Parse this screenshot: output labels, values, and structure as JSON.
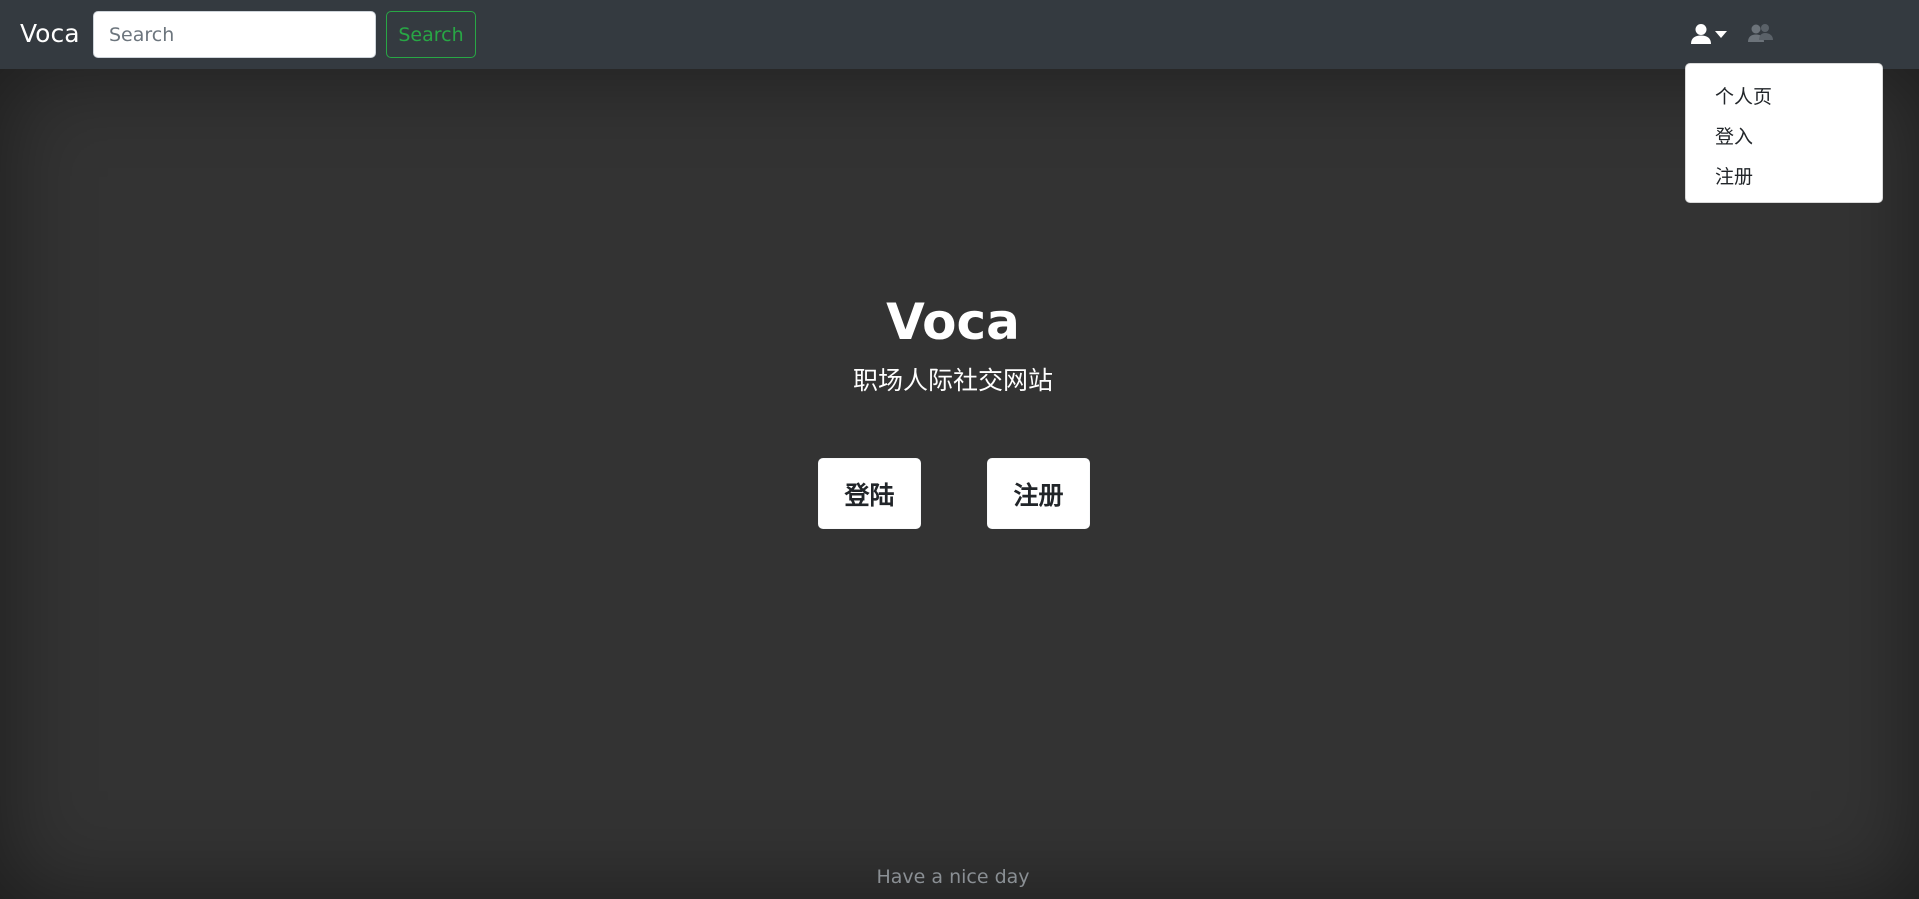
{
  "navbar": {
    "brand": "Voca",
    "search": {
      "placeholder": "Search",
      "value": "",
      "button_label": "Search"
    },
    "icons": {
      "user": "user-icon",
      "caret": "caret-down-icon",
      "friends": "friends-icon"
    },
    "colors": {
      "background": "#343a40",
      "search_accent": "#28a745"
    }
  },
  "user_dropdown": {
    "items": [
      {
        "label": "个人页"
      },
      {
        "label": "登入"
      },
      {
        "label": "注册"
      }
    ]
  },
  "hero": {
    "title": "Voca",
    "subtitle": "职场人际社交网站",
    "login_label": "登陆",
    "register_label": "注册"
  },
  "footer": {
    "text": "Have a nice day"
  },
  "page": {
    "background": "#333333"
  }
}
